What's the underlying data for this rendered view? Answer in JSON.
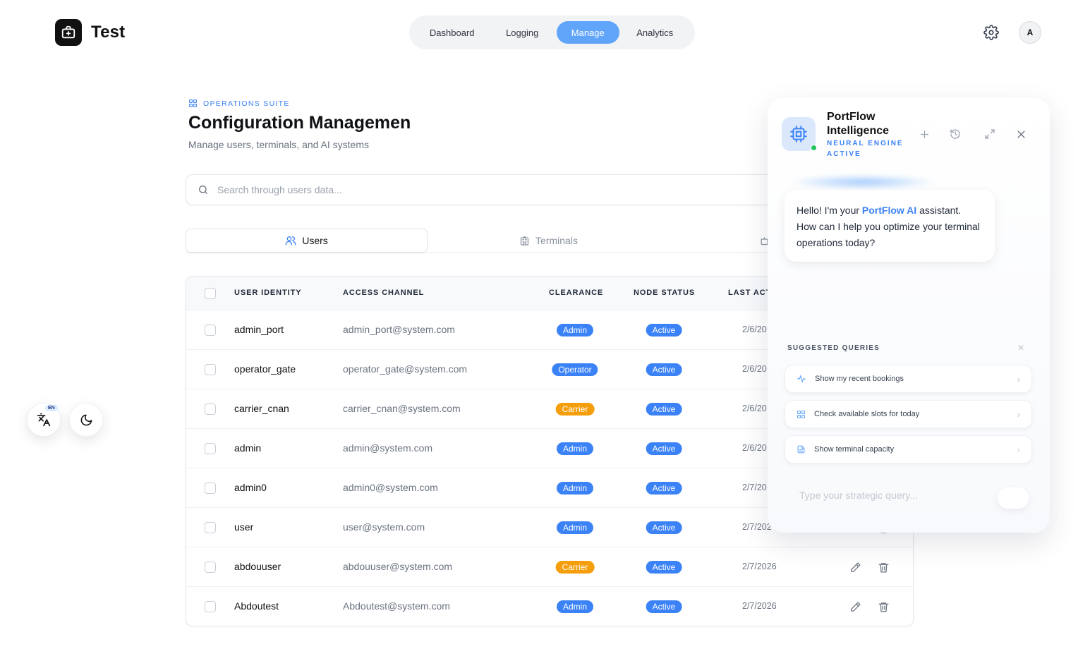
{
  "app": {
    "title": "Test"
  },
  "nav": {
    "items": [
      {
        "label": "Dashboard"
      },
      {
        "label": "Logging"
      },
      {
        "label": "Manage"
      },
      {
        "label": "Analytics"
      }
    ],
    "active": "Manage"
  },
  "header": {
    "avatar_initial": "A"
  },
  "page": {
    "eyebrow": "OPERATIONS SUITE",
    "title": "Configuration Managemen",
    "subtitle": "Manage users, terminals, and AI systems"
  },
  "search": {
    "placeholder": "Search through users data..."
  },
  "tabs": [
    {
      "label": "Users"
    },
    {
      "label": "Terminals"
    }
  ],
  "table": {
    "columns": [
      "USER IDENTITY",
      "ACCESS CHANNEL",
      "CLEARANCE",
      "NODE STATUS",
      "LAST ACT"
    ],
    "rows": [
      {
        "name": "admin_port",
        "email": "admin_port@system.com",
        "role": "Admin",
        "status": "Active",
        "date": "2/6/20"
      },
      {
        "name": "operator_gate",
        "email": "operator_gate@system.com",
        "role": "Operator",
        "status": "Active",
        "date": "2/6/20"
      },
      {
        "name": "carrier_cnan",
        "email": "carrier_cnan@system.com",
        "role": "Carrier",
        "status": "Active",
        "date": "2/6/20"
      },
      {
        "name": "admin",
        "email": "admin@system.com",
        "role": "Admin",
        "status": "Active",
        "date": "2/6/20"
      },
      {
        "name": "admin0",
        "email": "admin0@system.com",
        "role": "Admin",
        "status": "Active",
        "date": "2/7/20"
      },
      {
        "name": "user",
        "email": "user@system.com",
        "role": "Admin",
        "status": "Active",
        "date": "2/7/202"
      },
      {
        "name": "abdouuser",
        "email": "abdouuser@system.com",
        "role": "Carrier",
        "status": "Active",
        "date": "2/7/2026"
      },
      {
        "name": "Abdoutest",
        "email": "Abdoutest@system.com",
        "role": "Admin",
        "status": "Active",
        "date": "2/7/2026"
      }
    ]
  },
  "role_colors": {
    "Admin": "#3b82f6",
    "Operator": "#3b82f6",
    "Carrier": "#f59e0b"
  },
  "floating": {
    "lang_badge": "EN"
  },
  "ai": {
    "title": "PortFlow Intelligence",
    "subtitle": "NEURAL ENGINE ACTIVE",
    "greeting_prefix": "Hello! I'm your ",
    "greeting_brand": "PortFlow AI",
    "greeting_suffix": " assistant. How can I help you optimize your terminal operations today?",
    "suggestions_title": "SUGGESTED QUERIES",
    "suggestions": [
      {
        "label": "Show my recent bookings",
        "icon": "activity-icon"
      },
      {
        "label": "Check available slots for today",
        "icon": "grid-icon"
      },
      {
        "label": "Show terminal capacity",
        "icon": "document-icon"
      }
    ],
    "input_placeholder": "Type your strategic query..."
  }
}
